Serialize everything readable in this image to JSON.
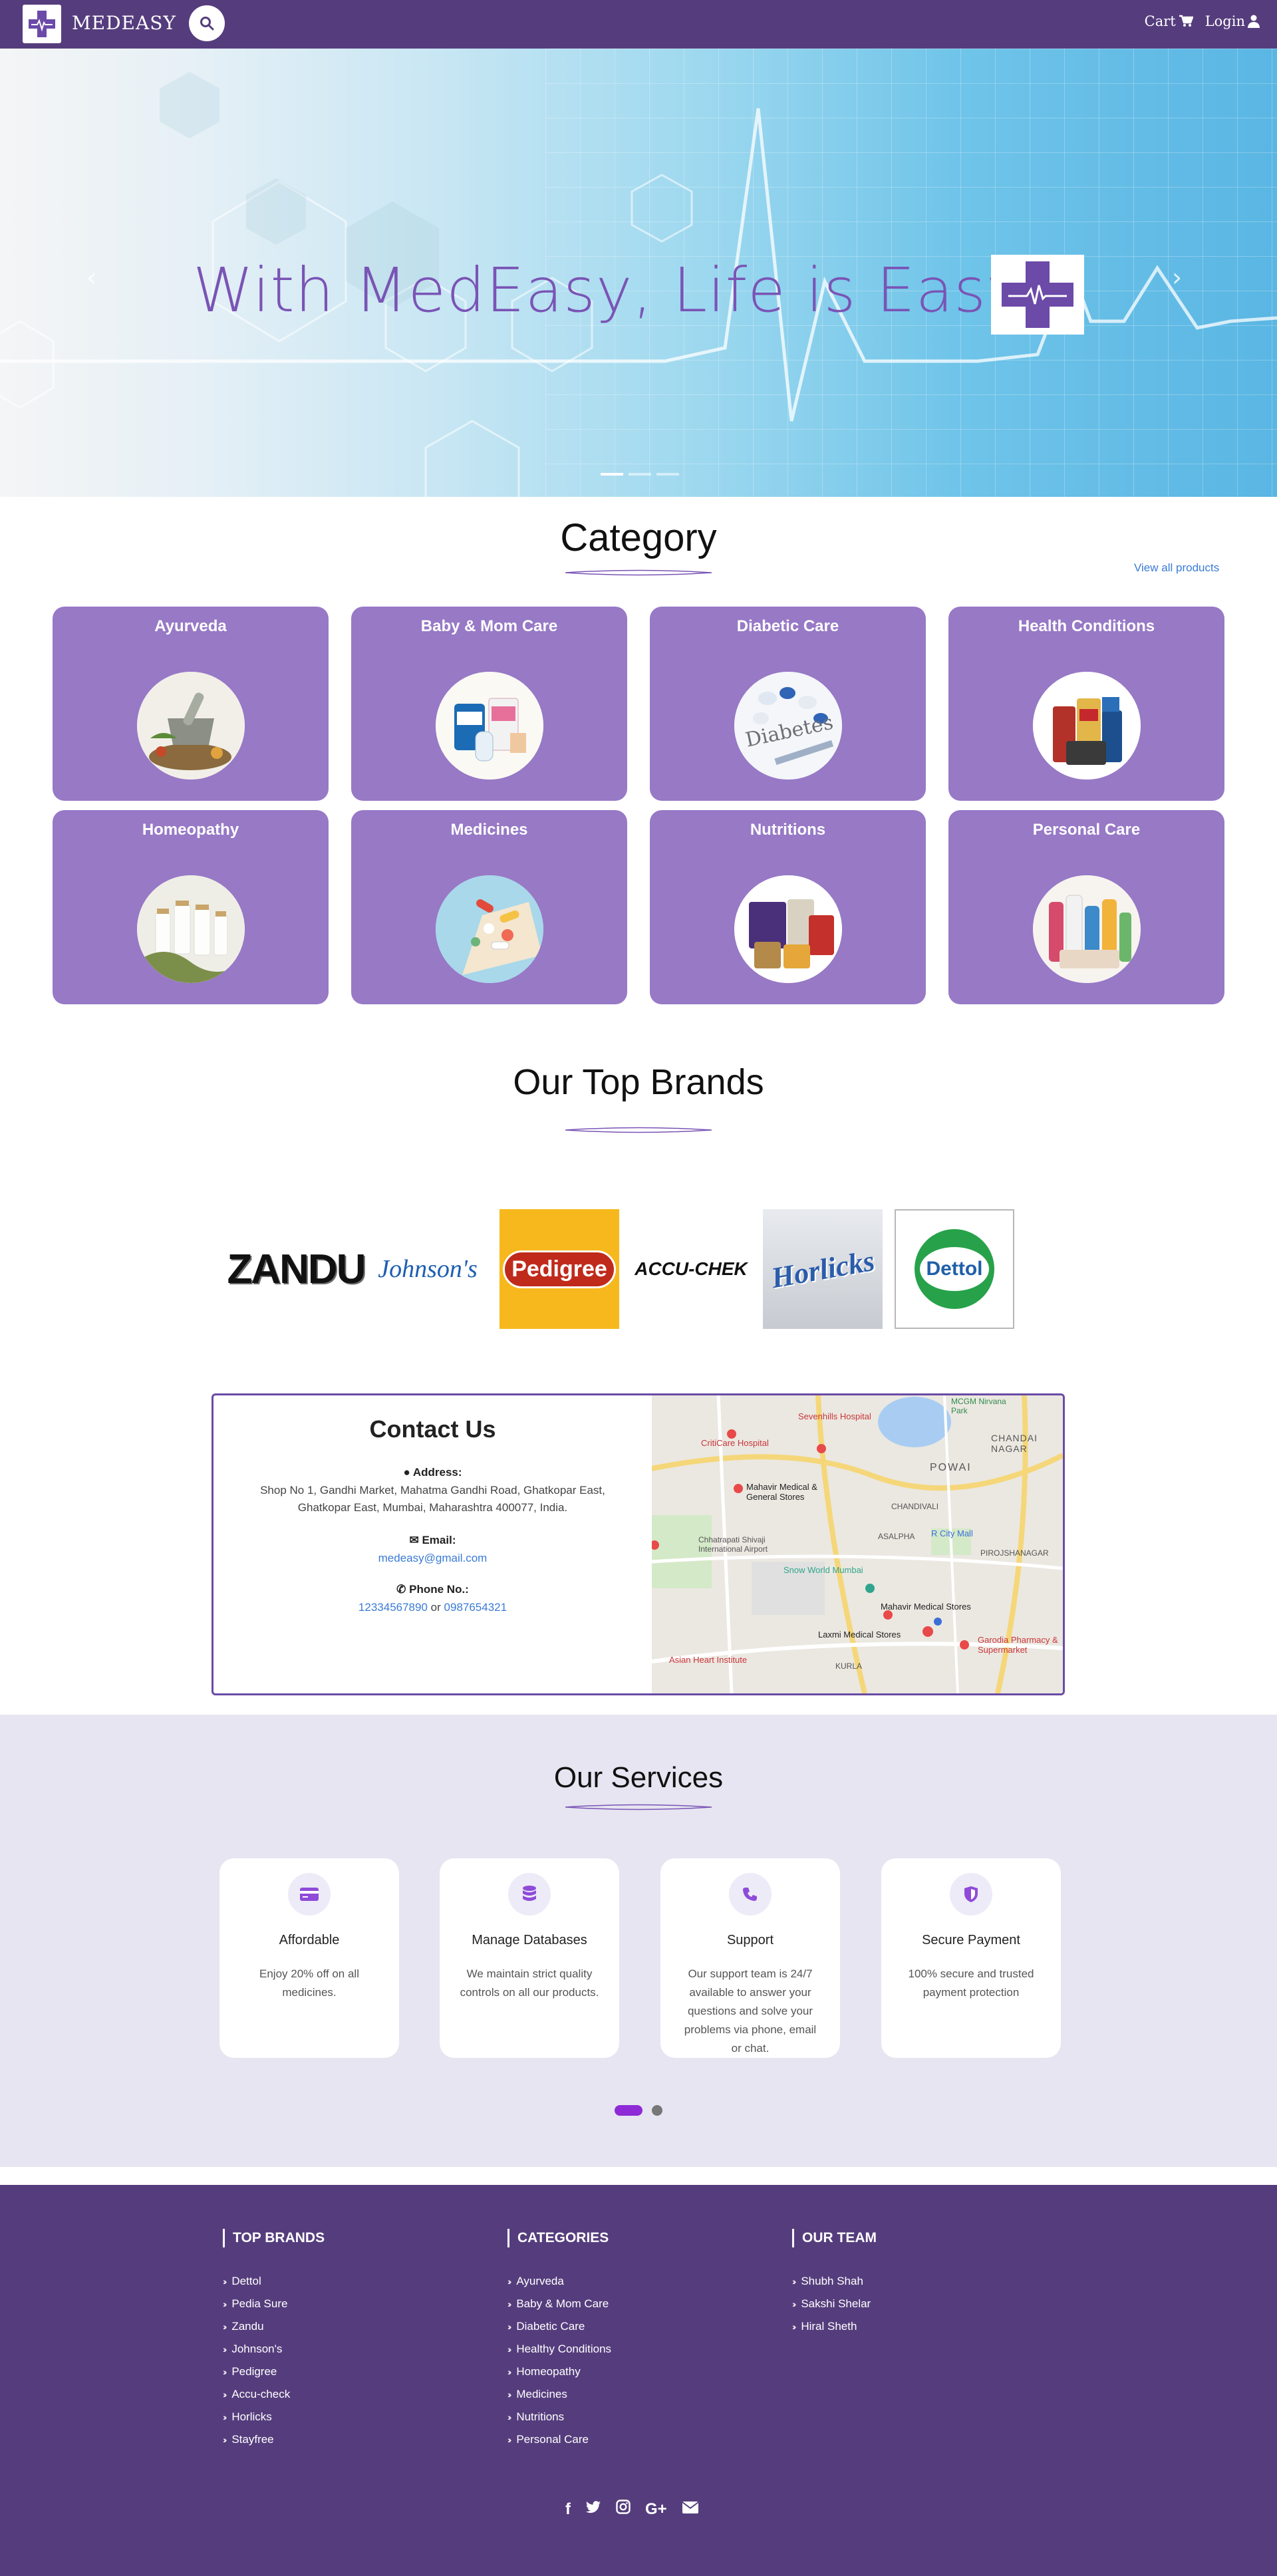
{
  "navbar": {
    "brand_name": "MEDEASY",
    "cart_label": "Cart",
    "login_label": "Login"
  },
  "hero": {
    "headline": "With MedEasy, Life is Easy.",
    "slide_count": 3,
    "active_slide": 1
  },
  "category": {
    "title": "Category",
    "view_all_label": "View all products",
    "items": [
      {
        "label": "Ayurveda",
        "icon": "ayurveda-mortar-icon"
      },
      {
        "label": "Baby & Mom Care",
        "icon": "baby-products-icon"
      },
      {
        "label": "Diabetic Care",
        "icon": "diabetes-icon"
      },
      {
        "label": "Health Conditions",
        "icon": "health-products-icon"
      },
      {
        "label": "Homeopathy",
        "icon": "homeopathy-bottles-icon"
      },
      {
        "label": "Medicines",
        "icon": "pills-icon"
      },
      {
        "label": "Nutritions",
        "icon": "nutrition-products-icon"
      },
      {
        "label": "Personal Care",
        "icon": "personal-care-products-icon"
      }
    ]
  },
  "brands": {
    "title": "Our Top Brands",
    "items": [
      "ZANDU",
      "Johnson's",
      "Pedigree",
      "ACCU-CHEK",
      "Horlicks",
      "Dettol"
    ]
  },
  "contact": {
    "title": "Contact Us",
    "address_label": "Address:",
    "address_line1": "Shop No 1, Gandhi Market, Mahatma Gandhi Road, Ghatkopar East,",
    "address_line2": "Ghatkopar East, Mumbai, Maharashtra 400077, India.",
    "email_label": "Email:",
    "email": "medeasy@gmail.com",
    "phone_label": "Phone No.:",
    "phone1": "12334567890",
    "phone_sep": "or",
    "phone2": "0987654321",
    "map_labels": {
      "l1": "Sevenhills Hospital",
      "l2": "CritiCare Hospital",
      "l3": "Mahavir Medical & General Stores",
      "l4": "POWAI",
      "l5": "CHANDIVALI",
      "l6": "ASALPHA",
      "l7": "R City Mall",
      "l8": "Snow World Mumbai",
      "l9": "Mahavir Medical Stores",
      "l10": "Laxmi Medical Stores",
      "l11": "Garodia Pharmacy & Supermarket",
      "l12": "Asian Heart Institute",
      "l13": "KURLA",
      "l14": "CHANDAI NAGAR",
      "l15": "PIROJSHANAGAR",
      "l16": "MCGM Nirvana Park",
      "l17": "Chhatrapati Shivaji International Airport"
    }
  },
  "services": {
    "title": "Our Services",
    "items": [
      {
        "title": "Affordable",
        "text": "Enjoy 20% off on all medicines.",
        "icon": "credit-card-icon"
      },
      {
        "title": "Manage Databases",
        "text": "We maintain strict quality controls on all our products.",
        "icon": "database-icon"
      },
      {
        "title": "Support",
        "text": "Our support team is 24/7 available to answer your questions and solve your problems via phone, email or chat.",
        "icon": "phone-icon"
      },
      {
        "title": "Secure Payment",
        "text": "100% secure and trusted payment protection",
        "icon": "shield-icon"
      }
    ]
  },
  "footer": {
    "columns": [
      {
        "heading": "TOP BRANDS",
        "items": [
          "Dettol",
          "Pedia Sure",
          "Zandu",
          "Johnson's",
          "Pedigree",
          "Accu-check",
          "Horlicks",
          "Stayfree"
        ]
      },
      {
        "heading": "CATEGORIES",
        "items": [
          "Ayurveda",
          "Baby & Mom Care",
          "Diabetic Care",
          "Healthy Conditions",
          "Homeopathy",
          "Medicines",
          "Nutritions",
          "Personal Care"
        ]
      },
      {
        "heading": "OUR TEAM",
        "items": [
          "Shubh Shah",
          "Sakshi Shelar",
          "Hiral Sheth"
        ]
      }
    ],
    "social": [
      "facebook-icon",
      "twitter-icon",
      "instagram-icon",
      "google-plus-icon",
      "envelope-icon"
    ]
  },
  "colors": {
    "primary": "#553d7d",
    "card_purple": "#9779c6",
    "accent_purple": "#7a54b5",
    "link_blue": "#3a7bd5",
    "services_bg": "#e6e5f1"
  }
}
